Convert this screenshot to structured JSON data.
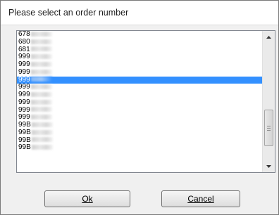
{
  "window": {
    "title": "Please select an order number"
  },
  "list": {
    "items": [
      {
        "label": "678",
        "selected": false
      },
      {
        "label": "680",
        "selected": false
      },
      {
        "label": "681",
        "selected": false
      },
      {
        "label": "999",
        "selected": false
      },
      {
        "label": "999",
        "selected": false
      },
      {
        "label": "999",
        "selected": false
      },
      {
        "label": "999",
        "selected": true
      },
      {
        "label": "999",
        "selected": false
      },
      {
        "label": "999",
        "selected": false
      },
      {
        "label": "999",
        "selected": false
      },
      {
        "label": "999",
        "selected": false
      },
      {
        "label": "999",
        "selected": false
      },
      {
        "label": "99B",
        "selected": false
      },
      {
        "label": "99B",
        "selected": false
      },
      {
        "label": "99B",
        "selected": false
      },
      {
        "label": "99B",
        "selected": false
      }
    ]
  },
  "scrollbar": {
    "position": 0.78,
    "up_icon": "arrow-up-icon",
    "down_icon": "arrow-down-icon"
  },
  "buttons": {
    "ok_label": "Ok",
    "cancel_label": "Cancel"
  },
  "colors": {
    "selection": "#3390ff"
  }
}
